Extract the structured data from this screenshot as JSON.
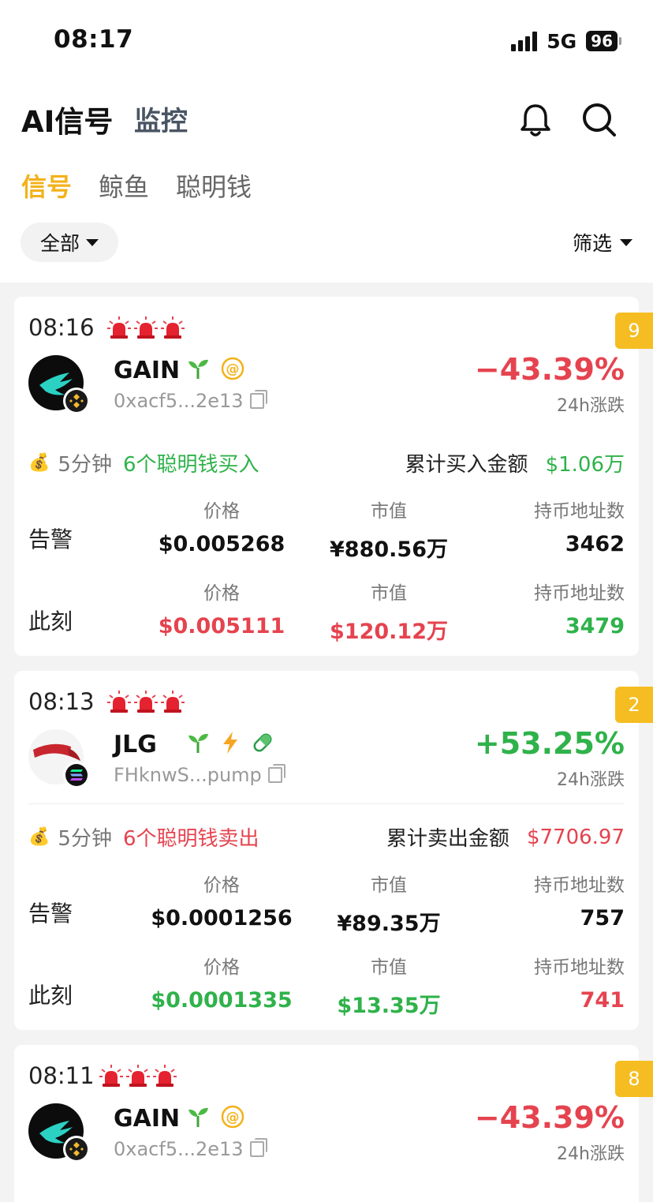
{
  "status_bar": {
    "time": "08:17",
    "network": "5G",
    "battery": "96"
  },
  "header": {
    "title": "AI信号",
    "secondary_tab": "监控"
  },
  "tabs": [
    {
      "label": "信号",
      "active": true
    },
    {
      "label": "鲸鱼",
      "active": false
    },
    {
      "label": "聪明钱",
      "active": false
    }
  ],
  "filters": {
    "category": "全部",
    "filter_label": "筛选"
  },
  "colors": {
    "accent": "#f3b21b",
    "up": "#2fb24a",
    "down": "#e5434f",
    "badge": "#f5bd22"
  },
  "labels": {
    "change_24h": "24h涨跌",
    "alert": "告警",
    "now": "此刻",
    "price": "价格",
    "market_cap": "市值",
    "holders": "持币地址数"
  },
  "cards": [
    {
      "time": "08:16",
      "badge": "9",
      "name": "GAIN",
      "address": "0xacf5...2e13",
      "chain": "bnb-icon",
      "change": "−43.39%",
      "change_dir": "down",
      "smart_money": {
        "period": "5分钟",
        "action": "6个聪明钱买入",
        "action_dir": "up",
        "cum_label": "累计买入金额",
        "cum_value": "$1.06万",
        "cum_dir": "up"
      },
      "alert": {
        "price": "$0.005268",
        "mcap": "¥880.56万",
        "holders": "3462"
      },
      "now": {
        "price": "$0.005111",
        "price_dir": "down",
        "mcap": "$120.12万",
        "mcap_dir": "down",
        "holders": "3479",
        "holders_dir": "up"
      }
    },
    {
      "time": "08:13",
      "badge": "2",
      "name": "JLG",
      "address": "FHknwS...pump",
      "chain": "solana-icon",
      "change": "+53.25%",
      "change_dir": "up",
      "smart_money": {
        "period": "5分钟",
        "action": "6个聪明钱卖出",
        "action_dir": "down",
        "cum_label": "累计卖出金额",
        "cum_value": "$7706.97",
        "cum_dir": "down"
      },
      "alert": {
        "price": "$0.0001256",
        "mcap": "¥89.35万",
        "holders": "757"
      },
      "now": {
        "price": "$0.0001335",
        "price_dir": "up",
        "mcap": "$13.35万",
        "mcap_dir": "up",
        "holders": "741",
        "holders_dir": "down"
      }
    },
    {
      "time": "08:11",
      "badge": "8",
      "name": "GAIN",
      "address": "0xacf5...2e13",
      "chain": "bnb-icon",
      "change": "−43.39%",
      "change_dir": "down"
    }
  ]
}
